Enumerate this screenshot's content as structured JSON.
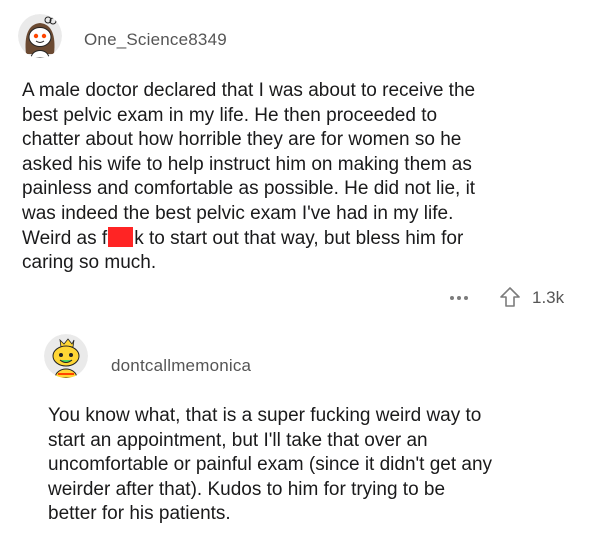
{
  "comment": {
    "username": "One_Science8349",
    "avatar_icon": "snoo-avatar-icon",
    "body_lines": [
      "A male doctor declared that I was about to receive the",
      "best pelvic exam in my life. He then proceeded to",
      "chatter about how horrible they are for women so he",
      "asked his wife to help instruct him on making them as",
      "painless and comfortable as possible. He did not lie, it",
      "was indeed the best pelvic exam I've had in my life.",
      "",
      "caring so much."
    ],
    "censored_line": {
      "before": "Weird as f",
      "after": "k to start out that way, but bless him for",
      "censor_color": "#ff2424"
    },
    "more_icon": "more-options-icon",
    "upvote_icon": "upvote-arrow-icon",
    "score": "1.3k"
  },
  "reply": {
    "username": "dontcallmemonica",
    "avatar_icon": "snoo-avatar-icon",
    "body_lines": [
      "You know what, that is a super fucking weird way to",
      "start an appointment, but I'll take that over an",
      "uncomfortable or painful exam (since it didn't get any",
      "weirder after that). Kudos to him for trying to be",
      "better for his patients."
    ]
  },
  "colors": {
    "text": "#1a1a1b",
    "meta": "#555555",
    "icon": "#7c7c7c",
    "censor": "#ff2424"
  }
}
